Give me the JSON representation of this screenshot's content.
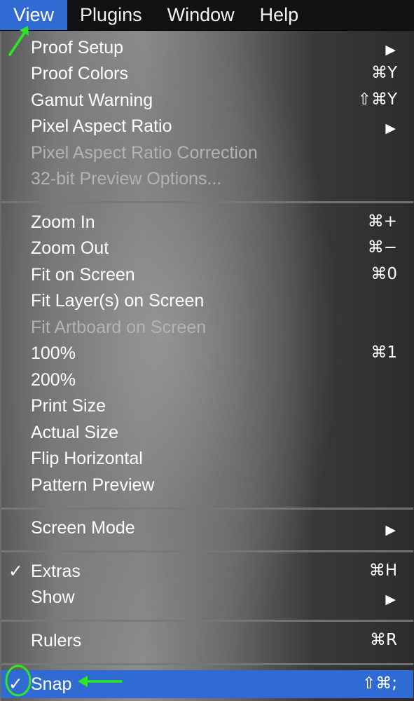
{
  "menubar": {
    "items": [
      {
        "label": "View",
        "active": true
      },
      {
        "label": "Plugins"
      },
      {
        "label": "Window"
      },
      {
        "label": "Help"
      }
    ]
  },
  "menu": {
    "items": [
      {
        "label": "Proof Setup",
        "submenu": true
      },
      {
        "label": "Proof Colors",
        "shortcut": "⌘Y"
      },
      {
        "label": "Gamut Warning",
        "shortcut": "⇧⌘Y"
      },
      {
        "label": "Pixel Aspect Ratio",
        "submenu": true
      },
      {
        "label": "Pixel Aspect Ratio Correction",
        "disabled": true
      },
      {
        "label": "32-bit Preview Options...",
        "disabled": true
      },
      {
        "label": "Zoom In",
        "shortcut": "⌘+"
      },
      {
        "label": "Zoom Out",
        "shortcut": "⌘−"
      },
      {
        "label": "Fit on Screen",
        "shortcut": "⌘0"
      },
      {
        "label": "Fit Layer(s) on Screen"
      },
      {
        "label": "Fit Artboard on Screen",
        "disabled": true
      },
      {
        "label": "100%",
        "shortcut": "⌘1"
      },
      {
        "label": "200%"
      },
      {
        "label": "Print Size"
      },
      {
        "label": "Actual Size"
      },
      {
        "label": "Flip Horizontal"
      },
      {
        "label": "Pattern Preview"
      },
      {
        "label": "Screen Mode",
        "submenu": true
      },
      {
        "label": "Extras",
        "shortcut": "⌘H",
        "checked": true
      },
      {
        "label": "Show",
        "submenu": true
      },
      {
        "label": "Rulers",
        "shortcut": "⌘R"
      },
      {
        "label": "Snap",
        "shortcut": "⇧⌘;",
        "checked": true,
        "highlighted": true
      }
    ]
  },
  "glyphs": {
    "submenu_arrow": "▶",
    "checkmark": "✓"
  },
  "colors": {
    "highlight": "#2f6bd3",
    "annotation": "#2ee81f",
    "menubar_bg": "#121214",
    "text": "#ffffff",
    "disabled_text": "#b3b3b3"
  }
}
